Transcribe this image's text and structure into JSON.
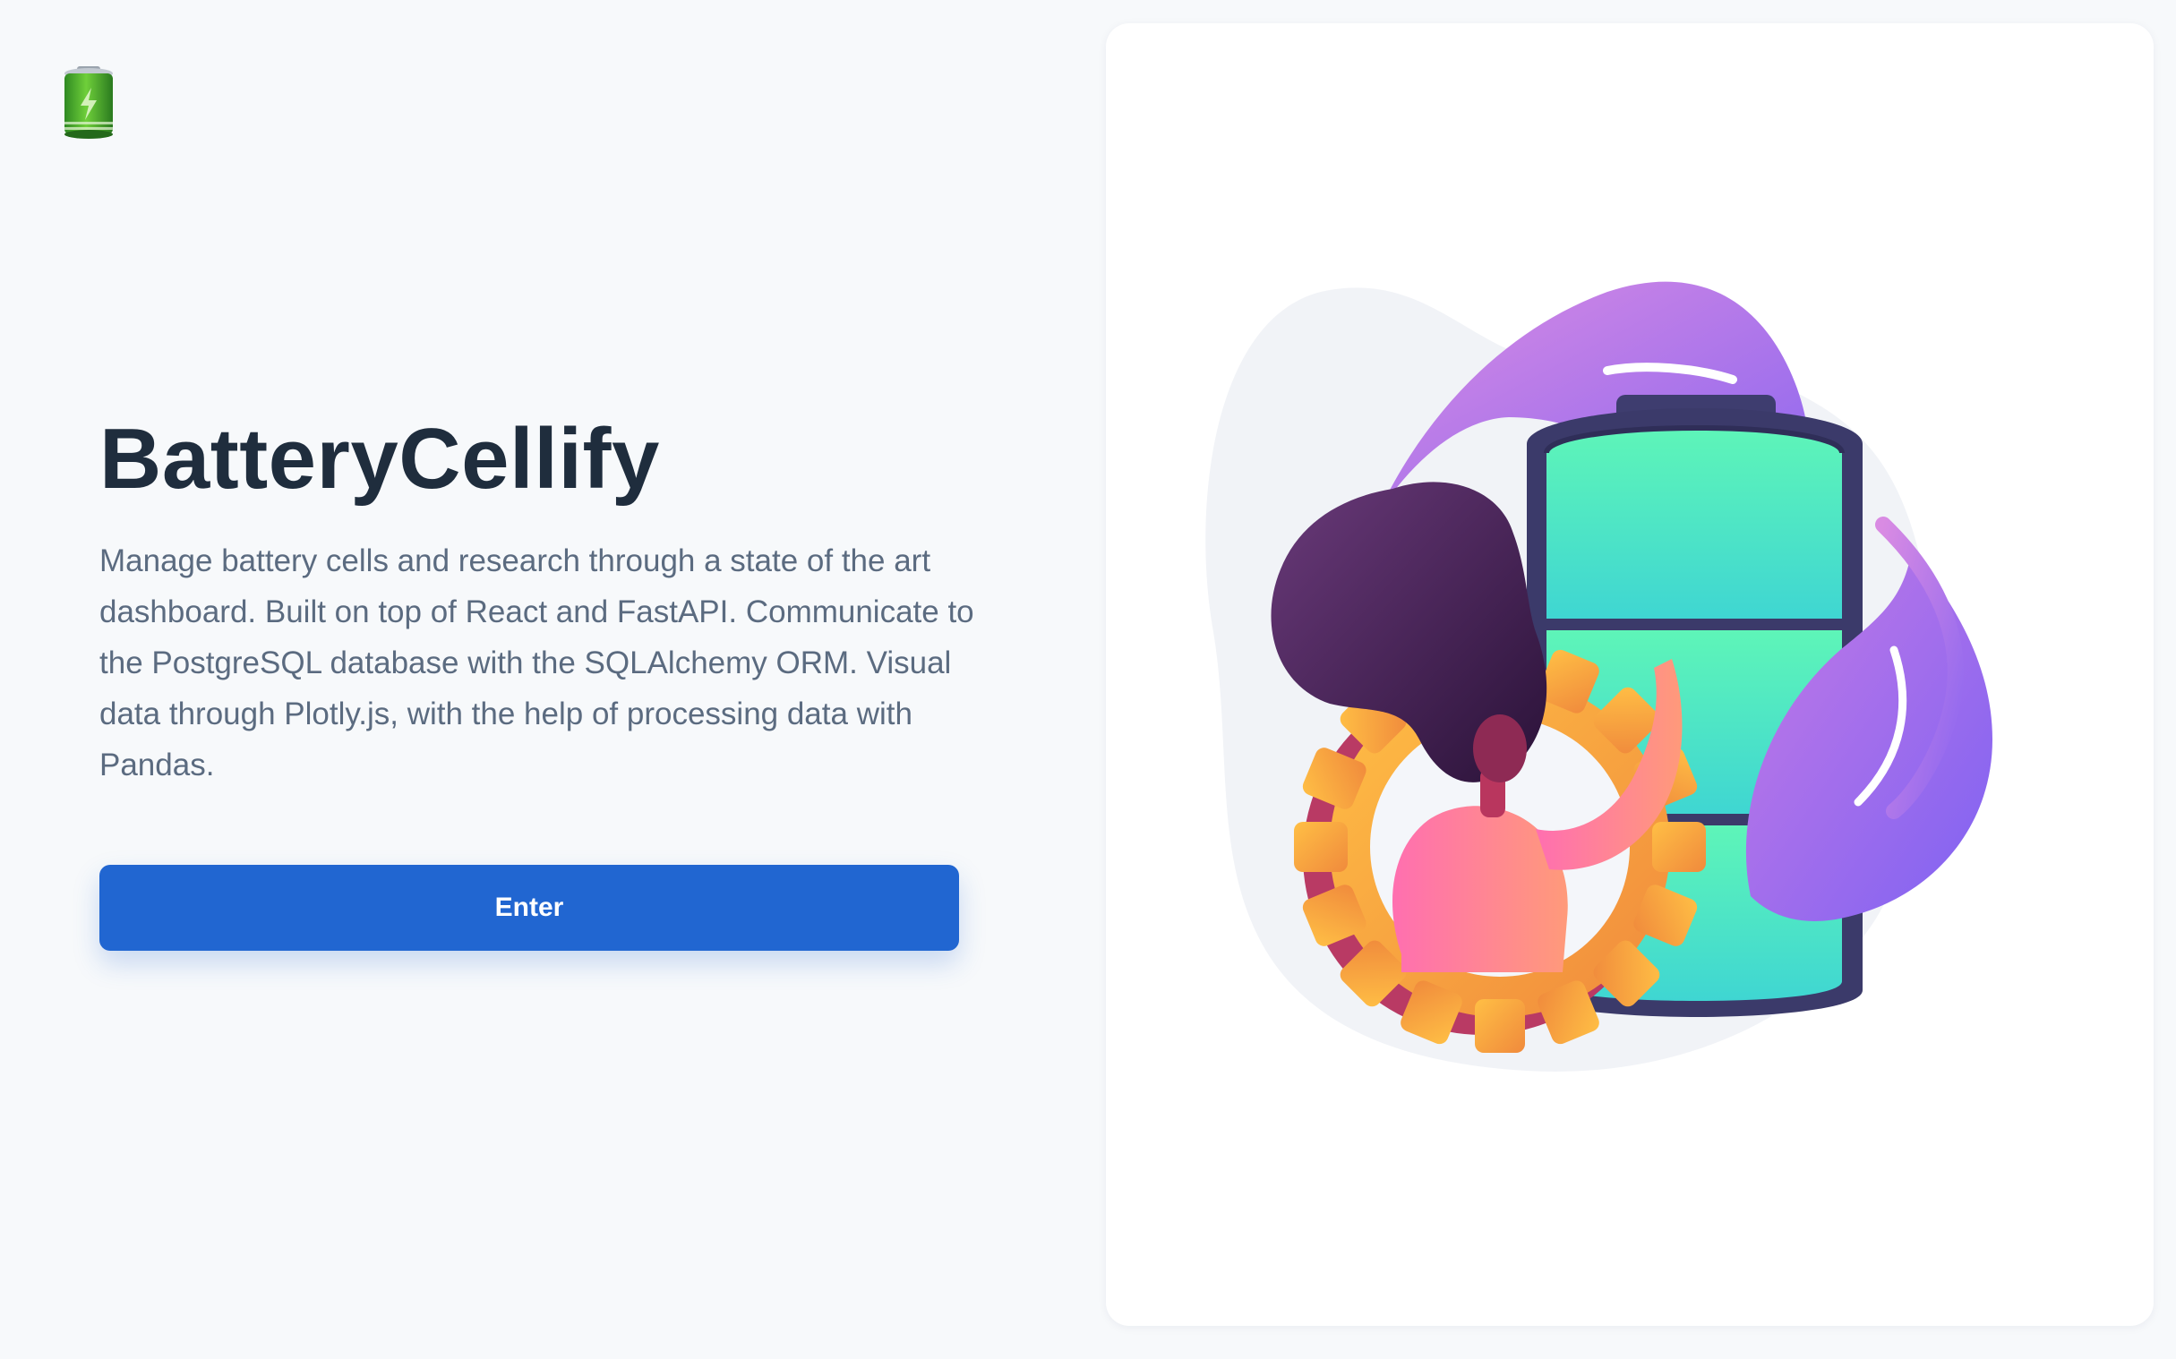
{
  "app": {
    "logo_icon": "battery-icon",
    "title": "BatteryCellify",
    "description": "Manage battery cells and research through a state of the art dashboard. Built on top of React and FastAPI. Communicate to the PostgreSQL database with the SQLAlchemy ORM. Visual data through Plotly.js, with the help of processing data with Pandas.",
    "enter_label": "Enter"
  },
  "colors": {
    "accent": "#2166d1",
    "title": "#1f2d3d",
    "body_text": "#5b6b80",
    "background": "#f7f9fb"
  },
  "illustration": {
    "icon": "battery-gear-person-illustration"
  }
}
